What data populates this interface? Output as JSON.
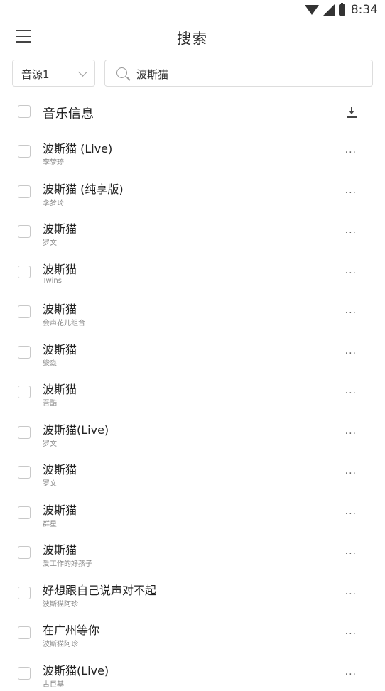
{
  "status_bar": {
    "time": "8:34"
  },
  "header": {
    "title": "搜索"
  },
  "search": {
    "source_label": "音源1",
    "query": "波斯猫"
  },
  "list_header": {
    "label": "音乐信息"
  },
  "songs": [
    {
      "title": "波斯猫 (Live)",
      "artist": "李梦琦"
    },
    {
      "title": "波斯猫 (纯享版)",
      "artist": "李梦琦"
    },
    {
      "title": "波斯猫",
      "artist": "罗文"
    },
    {
      "title": "波斯猫",
      "artist": "Twins"
    },
    {
      "title": "波斯猫",
      "artist": "会声花儿组合"
    },
    {
      "title": "波斯猫",
      "artist": "柴淼"
    },
    {
      "title": "波斯猫",
      "artist": "吾酷"
    },
    {
      "title": "波斯猫(Live)",
      "artist": "罗文"
    },
    {
      "title": "波斯猫",
      "artist": "罗文"
    },
    {
      "title": "波斯猫",
      "artist": "群星"
    },
    {
      "title": "波斯猫",
      "artist": "爱工作的好孩子"
    },
    {
      "title": "好想跟自己说声对不起",
      "artist": "波斯猫阿珍"
    },
    {
      "title": "在广州等你",
      "artist": "波斯猫阿珍"
    },
    {
      "title": "波斯猫(Live)",
      "artist": "古巨基"
    }
  ],
  "more_glyph": "···"
}
